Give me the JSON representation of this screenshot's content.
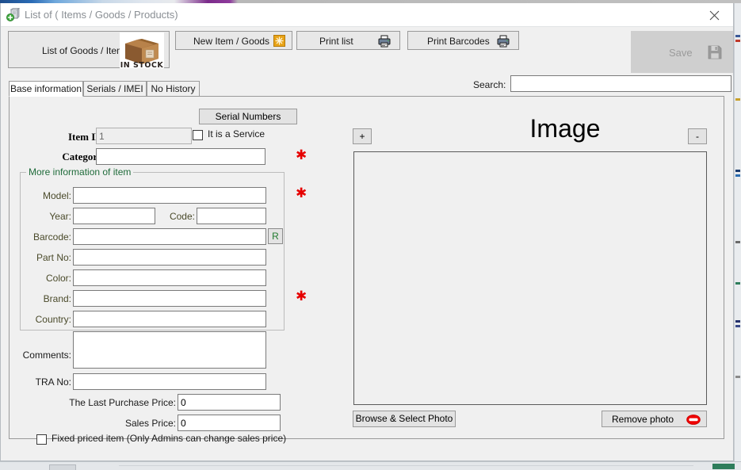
{
  "window": {
    "title": "List of ( Items / Goods / Products)",
    "app_icon": "add-document-icon",
    "close_icon": "close-icon"
  },
  "toolbar": {
    "list_goods_label": "List of Goods / Items",
    "list_goods_icon": "in-stock-box-icon",
    "in_stock_text": "IN STOCK",
    "new_item_label": "New Item / Goods",
    "new_item_icon": "new-item-starburst-icon",
    "print_list_label": "Print list",
    "print_list_icon": "printer-icon",
    "print_barcodes_label": "Print Barcodes",
    "print_barcodes_icon": "printer-icon",
    "save_label": "Save",
    "save_icon": "floppy-disk-icon",
    "save_enabled": false
  },
  "search": {
    "label": "Search:",
    "value": "",
    "placeholder": ""
  },
  "tabs": [
    {
      "label": "Base information",
      "active": true
    },
    {
      "label": "Serials / IMEI",
      "active": false
    },
    {
      "label": "No History",
      "active": false
    }
  ],
  "form": {
    "serial_numbers_button": "Serial Numbers",
    "item_id_label": "Item ID:",
    "item_id_value": "1",
    "is_service_label": "It is a Service",
    "is_service_checked": false,
    "category_label": "Category:",
    "category_value": "",
    "group_title": "More information of item",
    "model_label": "Model:",
    "model_value": "",
    "year_label": "Year:",
    "year_value": "",
    "code_label": "Code:",
    "code_value": "",
    "barcode_label": "Barcode:",
    "barcode_value": "",
    "barcode_button": "R",
    "part_no_label": "Part No:",
    "part_no_value": "",
    "color_label": "Color:",
    "color_value": "",
    "brand_label": "Brand:",
    "brand_value": "",
    "country_label": "Country:",
    "country_value": "",
    "comments_label": "Comments:",
    "comments_value": "",
    "tra_no_label": "TRA No:",
    "tra_no_value": "",
    "last_purchase_price_label": "The Last Purchase Price:",
    "last_purchase_price_value": "0",
    "sales_price_label": "Sales Price:",
    "sales_price_value": "0",
    "fixed_price_label": "Fixed priced item (Only Admins can change sales price)",
    "fixed_price_checked": false,
    "required_marker": "✱"
  },
  "image_panel": {
    "title": "Image",
    "add_button": "+",
    "remove_button": "-",
    "browse_button": "Browse & Select Photo",
    "remove_photo_button": "Remove photo",
    "remove_photo_icon": "no-entry-icon"
  },
  "colors": {
    "required_star": "#e60000",
    "group_title": "#1f6b3a",
    "field_label": "#4a4a2a",
    "window_bg": "#f0f0f0",
    "button_face": "#e3e3e3",
    "disabled_text": "#9b9b9b",
    "barcode_r": "#1f7a2e"
  }
}
